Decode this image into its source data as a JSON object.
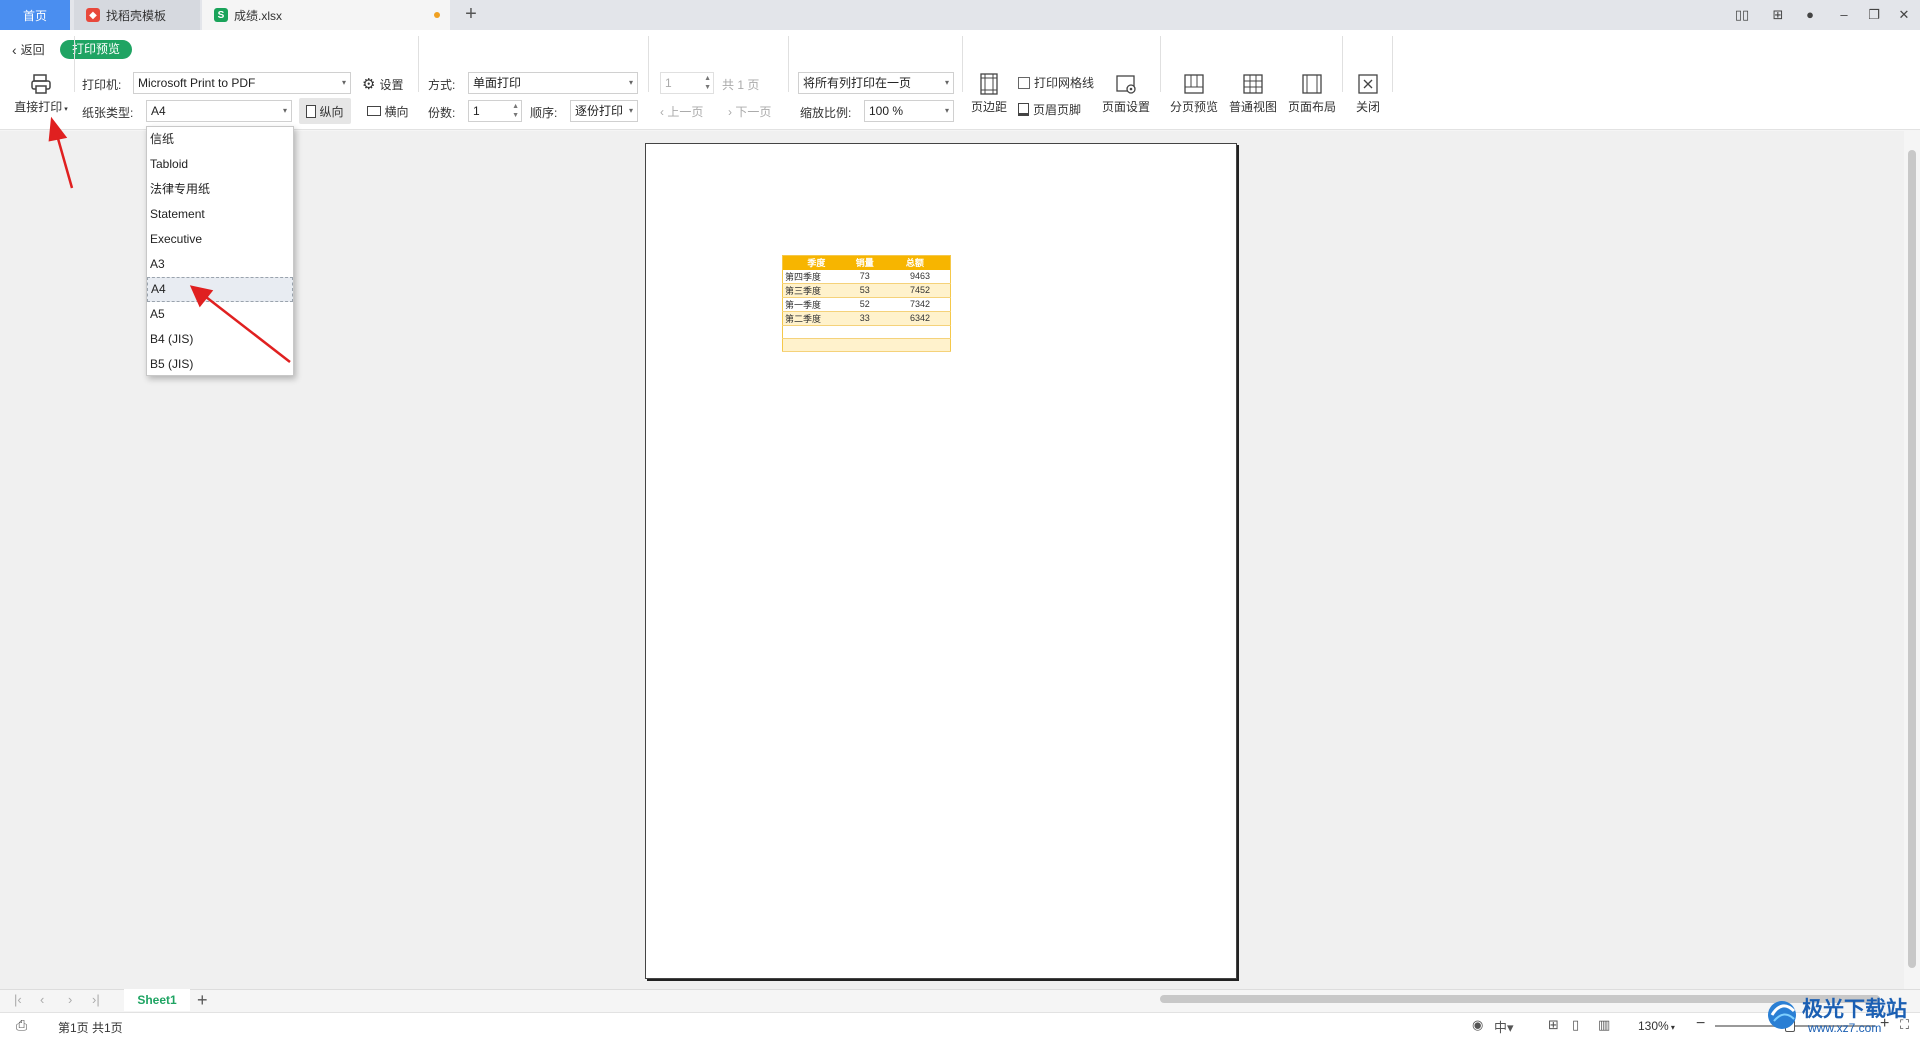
{
  "tabs": {
    "home": "首页",
    "templates": "找稻壳模板",
    "file": "成绩.xlsx"
  },
  "toolbar": {
    "back": "返回",
    "print_preview_badge": "打印预览",
    "direct_print": "直接打印",
    "printer_label": "打印机:",
    "printer_value": "Microsoft Print to PDF",
    "settings": "设置",
    "paper_type_label": "纸张类型:",
    "paper_type_value": "A4",
    "portrait": "纵向",
    "landscape": "横向",
    "mode_label": "方式:",
    "mode_value": "单面打印",
    "copies_label": "份数:",
    "copies_value": "1",
    "order_label": "顺序:",
    "order_value": "逐份打印",
    "page_num_value": "1",
    "total_pages": "共 1 页",
    "prev_page": "上一页",
    "next_page": "下一页",
    "fit_value": "将所有列打印在一页",
    "scale_label": "缩放比例:",
    "scale_value": "100 %",
    "margins": "页边距",
    "print_gridlines": "打印网格线",
    "header_footer": "页眉页脚",
    "page_setup": "页面设置",
    "page_break_preview": "分页预览",
    "normal_view": "普通视图",
    "page_layout": "页面布局",
    "close": "关闭"
  },
  "paper_dropdown": {
    "items": [
      "信纸",
      "Tabloid",
      "法律专用纸",
      "Statement",
      "Executive",
      "A3",
      "A4",
      "A5",
      "B4 (JIS)",
      "B5 (JIS)"
    ],
    "selected": "A4"
  },
  "sheet": {
    "headers": [
      "季度",
      "销量",
      "总额"
    ],
    "rows": [
      [
        "第四季度",
        "73",
        "9463"
      ],
      [
        "第三季度",
        "53",
        "7452"
      ],
      [
        "第一季度",
        "52",
        "7342"
      ],
      [
        "第二季度",
        "33",
        "6342"
      ]
    ]
  },
  "sheet_tabs": {
    "active": "Sheet1"
  },
  "status": {
    "page_info": "第1页 共1页",
    "zoom": "130%"
  },
  "watermark": {
    "brand": "极光下载站",
    "url": "www.xz7.com"
  },
  "colors": {
    "accent_green": "#1fa463",
    "home_tab_blue": "#4a8ef0",
    "table_header": "#f7b500",
    "annotation_red": "#e02020"
  }
}
